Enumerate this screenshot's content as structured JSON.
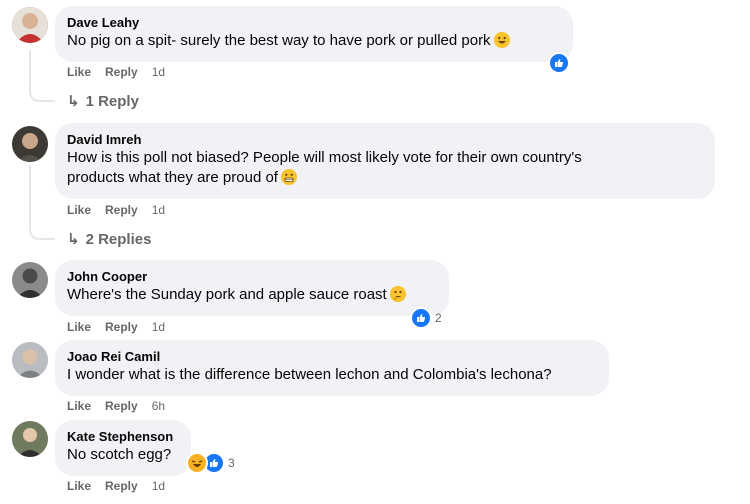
{
  "comments": [
    {
      "author": "Dave Leahy",
      "text": "No pig on a spit- surely the best way to have pork or pulled pork",
      "emoji": "grinning-face",
      "like_label": "Like",
      "reply_label": "Reply",
      "time": "1d",
      "reactions": [
        "like"
      ],
      "reaction_count": "",
      "replies_label": "1 Reply"
    },
    {
      "author": "David Imreh",
      "text_line1": "How is this poll not biased? People will most likely vote for their own country's",
      "text_line2": "products what they are proud of",
      "emoji": "grimacing-face",
      "like_label": "Like",
      "reply_label": "Reply",
      "time": "1d",
      "replies_label": "2 Replies"
    },
    {
      "author": "John Cooper",
      "text": "Where's the Sunday pork and apple sauce roast",
      "emoji": "thinking-face",
      "like_label": "Like",
      "reply_label": "Reply",
      "time": "1d",
      "reactions": [
        "like"
      ],
      "reaction_count": "2"
    },
    {
      "author": "Joao Rei Camil",
      "text": "I wonder what is the difference between lechon and Colombia's lechona?",
      "like_label": "Like",
      "reply_label": "Reply",
      "time": "6h"
    },
    {
      "author": "Kate Stephenson",
      "text": "No scotch egg?",
      "like_label": "Like",
      "reply_label": "Reply",
      "time": "1d",
      "reactions": [
        "haha",
        "like"
      ],
      "reaction_count": "3"
    }
  ],
  "colors": {
    "bubble": "#f0f2f5",
    "secondary_text": "#65676b",
    "like_blue": "#1877f2",
    "emoji_yellow": "#f7c32e"
  }
}
